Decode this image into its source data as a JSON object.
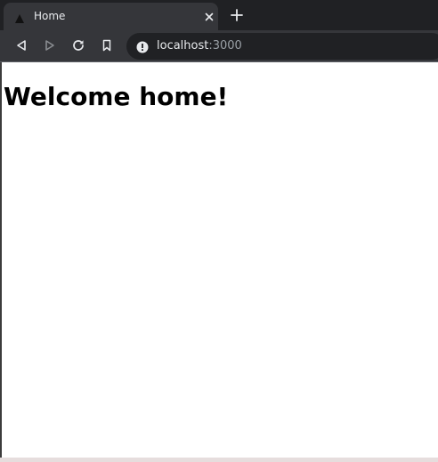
{
  "browser": {
    "tab": {
      "title": "Home",
      "favicon": "triangle-favicon-icon",
      "close_icon": "close-icon"
    },
    "new_tab_icon": "plus-icon",
    "toolbar": {
      "back_icon": "back-icon",
      "forward_icon": "forward-icon",
      "reload_icon": "reload-icon",
      "bookmark_icon": "bookmark-icon"
    },
    "omnibox": {
      "info_icon": "info-icon",
      "host": "localhost",
      "port": ":3000"
    }
  },
  "page": {
    "heading": "Welcome home!"
  },
  "colors": {
    "tabstrip_bg": "#202124",
    "toolbar_bg": "#35363a",
    "omnibox_bg": "#202124",
    "page_bg": "#ffffff",
    "text_light": "#e8eaed",
    "text_muted": "#9aa0a6",
    "heading_text": "#000000"
  }
}
